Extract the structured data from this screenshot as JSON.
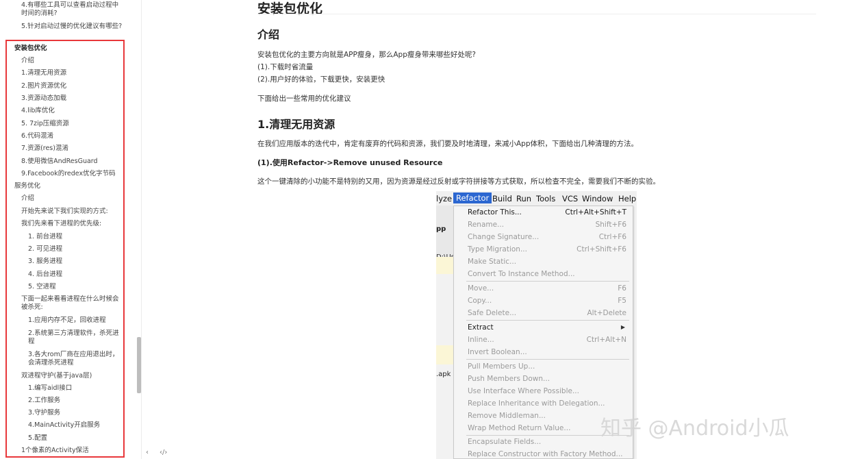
{
  "sidebar": {
    "items": [
      {
        "label": "4.有哪些工具可以查看启动过程中时间的消耗?"
      },
      {
        "label": "5.针对启动过慢的优化建议有哪些?"
      },
      {
        "label": "安装包优化"
      },
      {
        "label": "介绍"
      },
      {
        "label": "1.清理无用资源"
      },
      {
        "label": "2.图片资源优化"
      },
      {
        "label": "3.资源动态加载"
      },
      {
        "label": "4.lib库优化"
      },
      {
        "label": "5. 7zip压缩资源"
      },
      {
        "label": "6.代码混淆"
      },
      {
        "label": "7.资源(res)混淆"
      },
      {
        "label": "8.使用微信AndResGuard"
      },
      {
        "label": "9.Facebook的redex优化字节码"
      },
      {
        "label": "服务优化"
      },
      {
        "label": "介绍"
      },
      {
        "label": "开始先来说下我们实现的方式:"
      },
      {
        "label": "我们先来看下进程的优先级:"
      },
      {
        "label": "1. 前台进程"
      },
      {
        "label": "2. 可见进程"
      },
      {
        "label": "3. 服务进程"
      },
      {
        "label": "4. 后台进程"
      },
      {
        "label": "5. 空进程"
      },
      {
        "label": "下面一起来看看进程在什么时候会被杀死:"
      },
      {
        "label": "1.应用内存不足，回收进程"
      },
      {
        "label": "2.系统第三方清理软件，杀死进程"
      },
      {
        "label": "3.各大rom厂商在应用退出时，会清理杀死进程"
      },
      {
        "label": "双进程守护(基于java层)"
      },
      {
        "label": "1.编写aidl接口"
      },
      {
        "label": "2.工作服务"
      },
      {
        "label": "3.守护服务"
      },
      {
        "label": "4.MainActivity开启服务"
      },
      {
        "label": "5.配置"
      },
      {
        "label": "1个像素的Activity保活"
      }
    ],
    "footer": {
      "left": "‹",
      "right": "‹/›"
    }
  },
  "article": {
    "title": "安装包优化",
    "intro_heading": "介绍",
    "intro_lines": [
      "安装包优化的主要方向就是APP瘦身，那么App瘦身带来哪些好处呢?",
      " (1).下载时省流量",
      " (2).用户好的体验，下载更快，安装更快"
    ],
    "intro_tail": "下面给出一些常用的优化建议",
    "section1_heading": "1.清理无用资源",
    "section1_text": "在我们应用版本的迭代中，肯定有废弃的代码和资源，我们要及时地清理，来减小App体积，下面给出几种清理的方法。",
    "sub1_heading": "(1).使用Refactor->Remove unused Resource",
    "sub1_text": "这个一键清除的小功能不是特别的又用，因为资源是经过反射或字符拼接等方式获取，所以检查不完全，需要我们不断的实验。"
  },
  "ide": {
    "menubar": [
      "lyze",
      "Refactor",
      "Build",
      "Run",
      "Tools",
      "VCS",
      "Window",
      "Help"
    ],
    "strip_texts": [
      "pp",
      "D:\\Us",
      ".apk"
    ],
    "menu_items": [
      {
        "label": "Refactor This...",
        "shortcut": "Ctrl+Alt+Shift+T",
        "enabled": true
      },
      {
        "label": "Rename...",
        "shortcut": "Shift+F6",
        "enabled": false
      },
      {
        "label": "Change Signature...",
        "shortcut": "Ctrl+F6",
        "enabled": false
      },
      {
        "label": "Type Migration...",
        "shortcut": "Ctrl+Shift+F6",
        "enabled": false
      },
      {
        "label": "Make Static...",
        "shortcut": "",
        "enabled": false
      },
      {
        "label": "Convert To Instance Method...",
        "shortcut": "",
        "enabled": false
      },
      {
        "label": "Move...",
        "shortcut": "F6",
        "enabled": false
      },
      {
        "label": "Copy...",
        "shortcut": "F5",
        "enabled": false
      },
      {
        "label": "Safe Delete...",
        "shortcut": "Alt+Delete",
        "enabled": false
      },
      {
        "label": "Extract",
        "shortcut": "",
        "enabled": true
      },
      {
        "label": "Inline...",
        "shortcut": "Ctrl+Alt+N",
        "enabled": false
      },
      {
        "label": "Invert Boolean...",
        "shortcut": "",
        "enabled": false
      },
      {
        "label": "Pull Members Up...",
        "shortcut": "",
        "enabled": false
      },
      {
        "label": "Push Members Down...",
        "shortcut": "",
        "enabled": false
      },
      {
        "label": "Use Interface Where Possible...",
        "shortcut": "",
        "enabled": false
      },
      {
        "label": "Replace Inheritance with Delegation...",
        "shortcut": "",
        "enabled": false
      },
      {
        "label": "Remove Middleman...",
        "shortcut": "",
        "enabled": false
      },
      {
        "label": "Wrap Method Return Value...",
        "shortcut": "",
        "enabled": false
      },
      {
        "label": "Encapsulate Fields...",
        "shortcut": "",
        "enabled": false
      },
      {
        "label": "Replace Constructor with Factory Method...",
        "shortcut": "",
        "enabled": false
      }
    ]
  },
  "watermark": "知乎 @Android小瓜",
  "colors": {
    "highlight": "#e8373a",
    "menu_active": "#2c67d1"
  }
}
